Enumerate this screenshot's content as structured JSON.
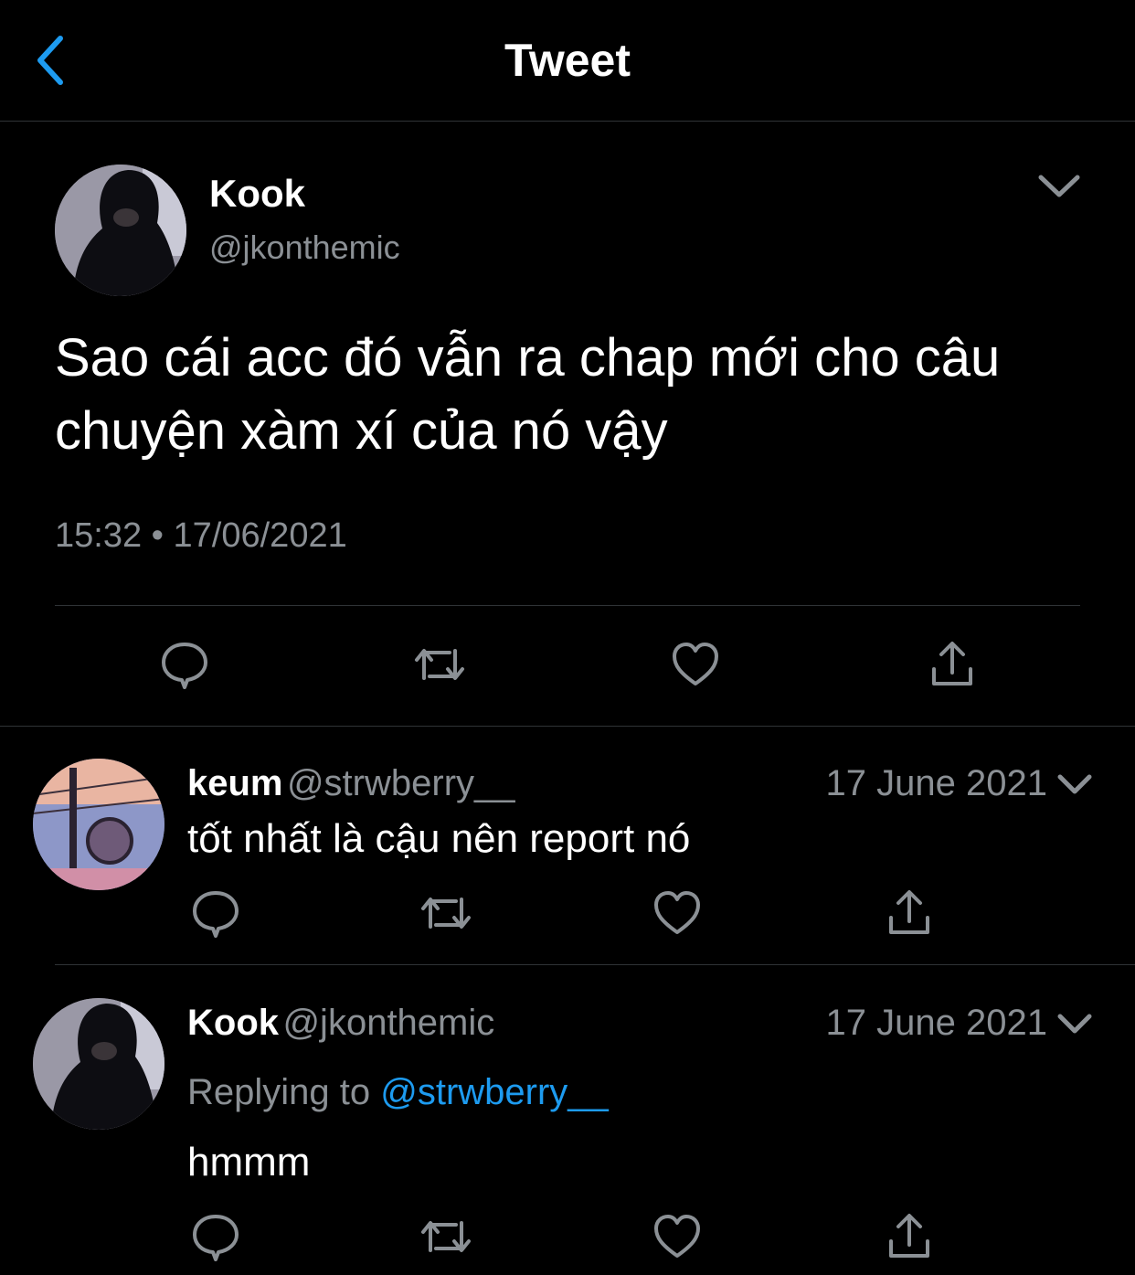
{
  "header": {
    "title": "Tweet"
  },
  "main_tweet": {
    "name": "Kook",
    "handle": "@jkonthemic",
    "text": "Sao cái acc đó vẫn ra chap mới cho câu chuyện xàm xí của nó vậy",
    "time": "15:32",
    "separator": "•",
    "date": "17/06/2021"
  },
  "replies": [
    {
      "name": "keum",
      "handle": "@strwberry__",
      "date": "17 June 2021",
      "text": "tốt nhất là cậu nên report nó"
    },
    {
      "name": "Kook",
      "handle": "@jkonthemic",
      "date": "17 June 2021",
      "replying_label": "Replying to",
      "replying_to": "@strwberry__",
      "text": "hmmm"
    }
  ],
  "colors": {
    "accent": "#1d9bf0",
    "secondary_text": "#8b9095",
    "divider": "#2f3336",
    "background": "#000000"
  },
  "icons": [
    "back-chevron-icon",
    "chevron-down-icon",
    "reply-icon",
    "retweet-icon",
    "like-icon",
    "share-icon"
  ]
}
